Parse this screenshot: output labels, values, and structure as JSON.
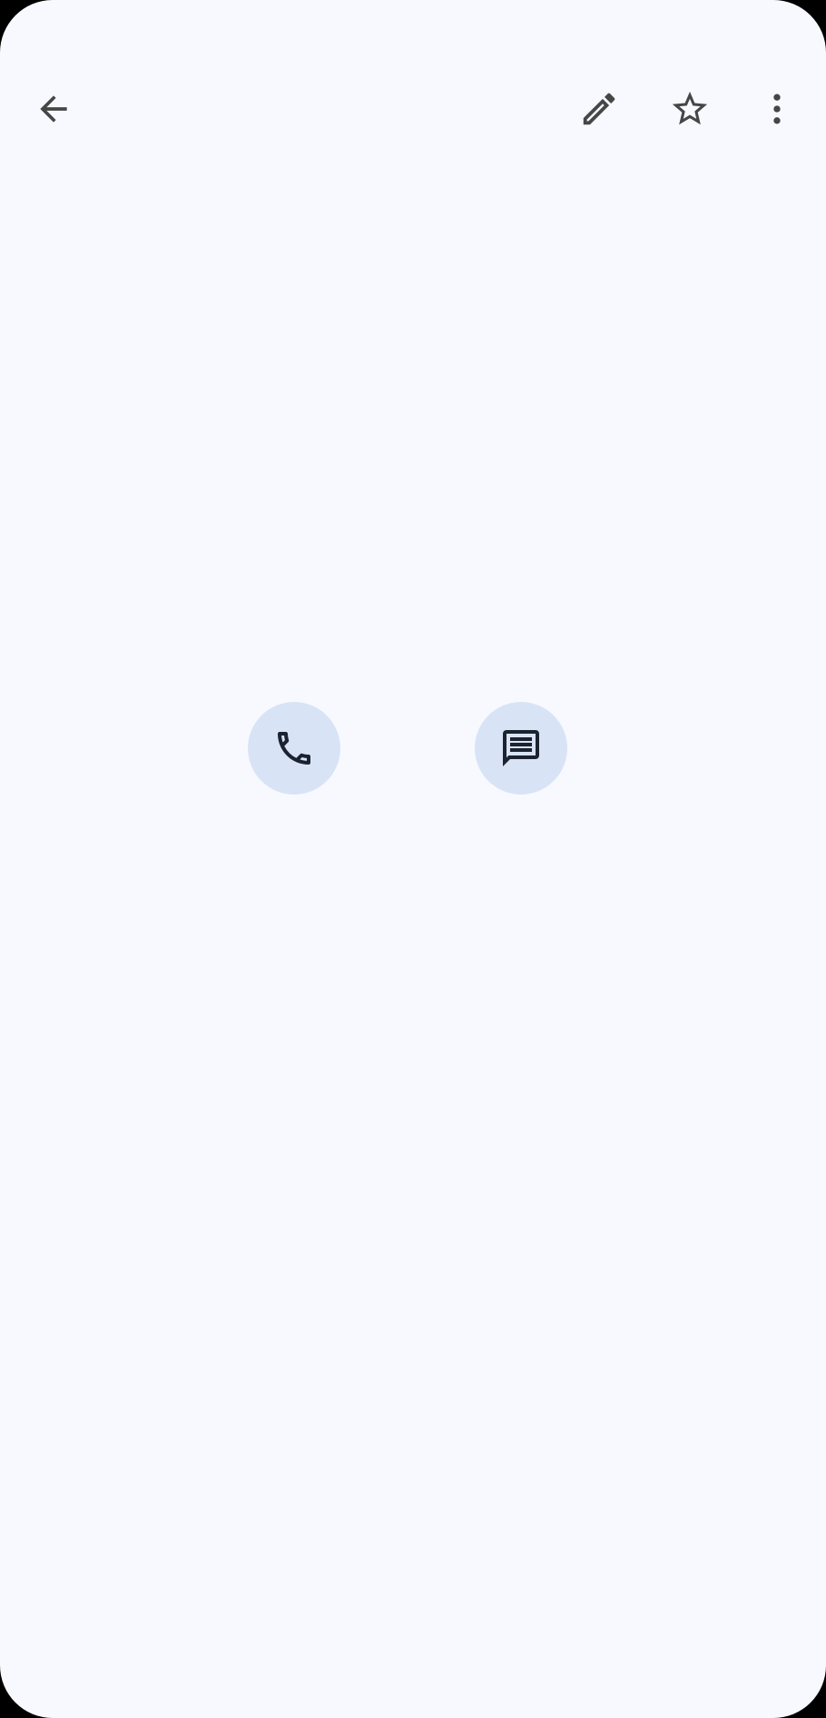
{
  "theme": {
    "background": "#f8f9fe",
    "icon_color": "#444746",
    "action_bg": "#d8e4f6",
    "action_icon_color": "#1b2230"
  },
  "toolbar": {
    "back_icon": "arrow-back-icon",
    "edit_icon": "pencil-icon",
    "star_icon": "star-outline-icon",
    "more_icon": "more-vert-icon"
  },
  "actions": {
    "call_icon": "phone-icon",
    "message_icon": "message-icon"
  }
}
